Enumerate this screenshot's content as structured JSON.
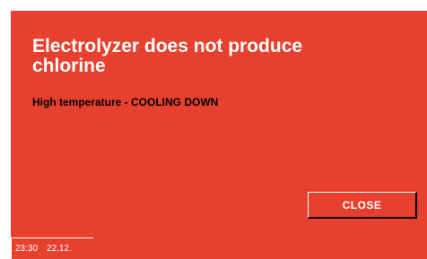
{
  "alert": {
    "title": "Electrolyzer does not produce chlorine",
    "message": "High temperature - COOLING DOWN",
    "close_label": "CLOSE"
  },
  "status_bar": {
    "time": "23:30",
    "date": "22.12."
  },
  "colors": {
    "alert_background": "#e8402f",
    "text_primary": "#ffffff",
    "text_secondary": "#000000"
  }
}
